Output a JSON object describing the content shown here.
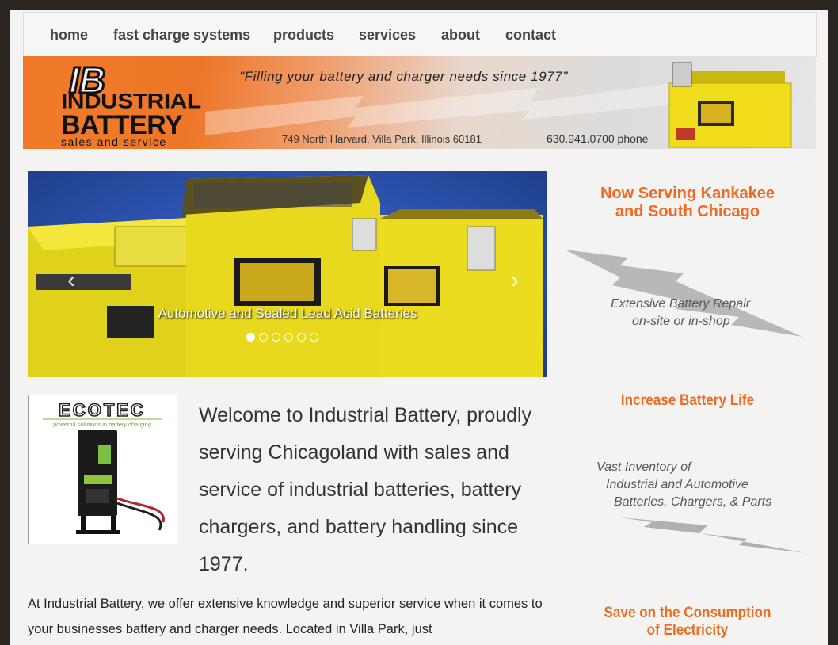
{
  "nav": {
    "items": [
      {
        "label": "home"
      },
      {
        "label": "fast charge systems"
      },
      {
        "label": "products"
      },
      {
        "label": "services"
      },
      {
        "label": "about"
      },
      {
        "label": "contact"
      }
    ]
  },
  "banner": {
    "logo_mark": "IB",
    "logo_line1": "INDUSTRIAL",
    "logo_line2": "BATTERY",
    "logo_line3": "sales and service",
    "tagline": "\"Filling your battery and charger needs since 1977\"",
    "address": "749 North Harvard, Villa Park, Illinois 60181",
    "phone": "630.941.0700 phone"
  },
  "slider": {
    "caption": "Automotive and Sealed Lead Acid Batteries",
    "prev_icon": "chevron-left-icon",
    "next_icon": "chevron-right-icon",
    "active_slide": 1,
    "slide_count": 6
  },
  "ecotec": {
    "brand": "ECOTEC",
    "tagline": "powerful solutions in battery charging"
  },
  "welcome": "Welcome to Industrial Battery, proudly serving Chicagoland with sales and service of industrial batteries, battery chargers, and battery handling since 1977.",
  "intro": "At Industrial Battery, we offer extensive knowledge and superior service when it comes to your businesses battery and charger needs. Located in Villa Park, just",
  "sidebar": {
    "heading1": "Now Serving Kankakee and South Chicago",
    "repair_line1": "Extensive Battery Repair",
    "repair_line2": "on-site or in-shop",
    "heading2": "Increase Battery Life",
    "inventory_line1": "Vast Inventory of",
    "inventory_line2": "Industrial and Automotive",
    "inventory_line3": "Batteries, Chargers, & Parts",
    "heading3_line1": "Save on the Consumption",
    "heading3_line2": "of Electricity"
  },
  "colors": {
    "accent_orange": "#f06a22",
    "battery_yellow": "#e8d81e",
    "slider_blue": "#2a4fa8"
  }
}
